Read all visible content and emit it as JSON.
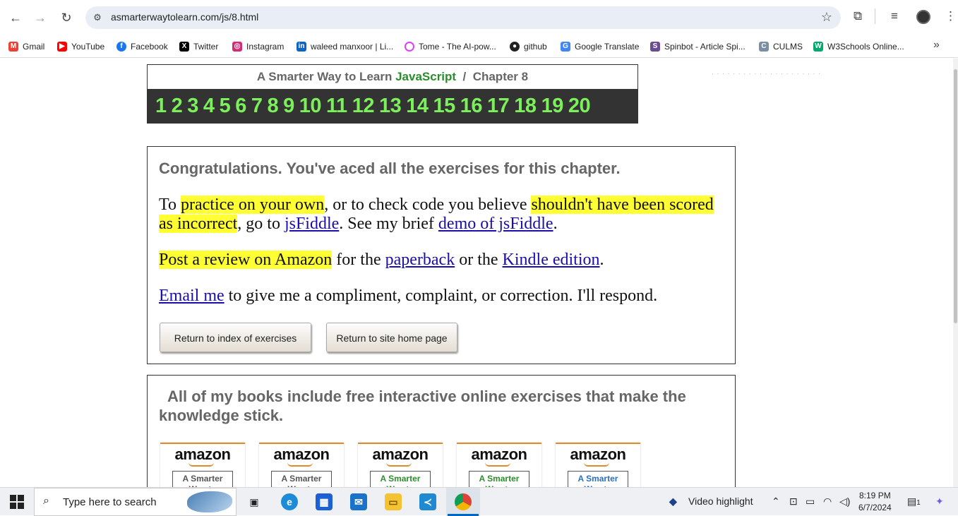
{
  "browser": {
    "url": "asmarterwaytolearn.com/js/8.html",
    "nav": {
      "back": "←",
      "forward": "→",
      "reload": "↻"
    },
    "icons": [
      "site-settings-icon",
      "star-icon",
      "extensions-icon",
      "media-icon",
      "profile-avatar",
      "menu-icon"
    ]
  },
  "bookmarks": [
    {
      "label": "Gmail",
      "icon": "gmail-icon",
      "color": "#ea4335"
    },
    {
      "label": "YouTube",
      "icon": "youtube-icon",
      "color": "#ff0000"
    },
    {
      "label": "Facebook",
      "icon": "facebook-icon",
      "color": "#1877f2"
    },
    {
      "label": "Twitter",
      "icon": "x-icon",
      "color": "#000000"
    },
    {
      "label": "Instagram",
      "icon": "instagram-icon",
      "color": "#d62976"
    },
    {
      "label": "waleed manxoor | Li...",
      "icon": "linkedin-icon",
      "color": "#0a66c2"
    },
    {
      "label": "Tome - The AI-pow...",
      "icon": "tome-icon",
      "color": "#e040fb"
    },
    {
      "label": "github",
      "icon": "github-icon",
      "color": "#222222"
    },
    {
      "label": "Google Translate",
      "icon": "translate-icon",
      "color": "#4285f4"
    },
    {
      "label": "Spinbot - Article Spi...",
      "icon": "spinbot-icon",
      "color": "#6a4c93"
    },
    {
      "label": "CULMS",
      "icon": "culms-icon",
      "color": "#7a8fa6"
    },
    {
      "label": "W3Schools Online...",
      "icon": "w3schools-icon",
      "color": "#04aa6d"
    }
  ],
  "chapter": {
    "title_prefix": "A Smarter Way to Learn ",
    "title_js": "JavaScript",
    "title_suffix": "  /  Chapter 8",
    "numbers": [
      "1",
      "2",
      "3",
      "4",
      "5",
      "6",
      "7",
      "8",
      "9",
      "10",
      "11",
      "12",
      "13",
      "14",
      "15",
      "16",
      "17",
      "18",
      "19",
      "20"
    ]
  },
  "congrats": {
    "heading": "Congratulations. You've aced all the exercises for this chapter.",
    "p1": {
      "t1": "To ",
      "hl1": "practice on your own",
      "t2": ", or to check code you believe ",
      "hl2": "shouldn't have been scored as incorrect",
      "t3": ", go to ",
      "link1": "jsFiddle",
      "t4": ". See my brief ",
      "link2": "demo of jsFiddle",
      "t5": "."
    },
    "p2": {
      "hl": "Post a review on Amazon",
      "t1": " for the ",
      "link1": "paperback",
      "t2": " or the ",
      "link2": "Kindle edition",
      "t3": "."
    },
    "p3": {
      "link": "Email me",
      "t1": " to give me a compliment, complaint, or correction. I'll respond."
    },
    "btn_index": "Return to index of exercises",
    "btn_home": "Return to site home page"
  },
  "books": {
    "heading": "All of my books include free interactive online exercises that make the knowledge stick.",
    "items": [
      {
        "brand": "amazon",
        "cover": "A Smarter Way to",
        "color": "#555555"
      },
      {
        "brand": "amazon",
        "cover": "A Smarter Way to",
        "color": "#555555"
      },
      {
        "brand": "amazon",
        "cover": "A Smarter Way to",
        "color": "#2a8f2a"
      },
      {
        "brand": "amazon",
        "cover": "A Smarter Way to",
        "color": "#2a8f2a"
      },
      {
        "brand": "amazon",
        "cover": "A Smarter Way to",
        "color": "#2a6fc0"
      }
    ]
  },
  "taskbar": {
    "search_placeholder": "Type here to search",
    "news": "Video highlight",
    "time": "8:19 PM",
    "date": "6/7/2024",
    "notifications": "1"
  }
}
